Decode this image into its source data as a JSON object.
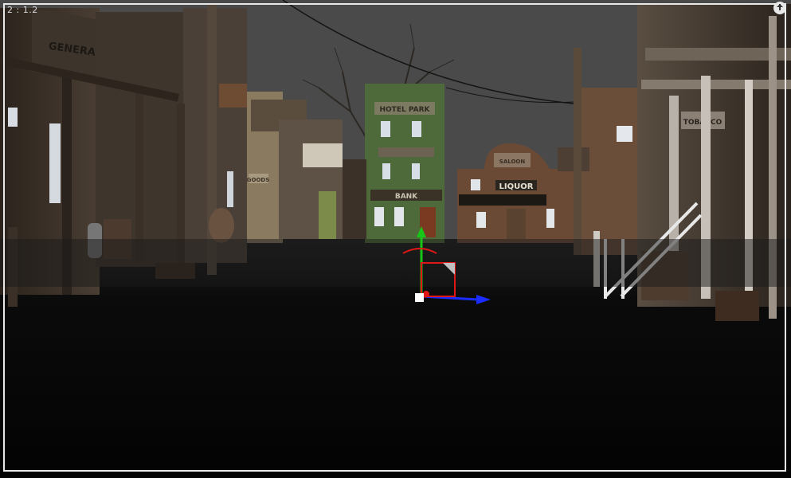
{
  "viewport": {
    "aspect_label": "2 : 1.2",
    "signs": {
      "left_building": "GENERAL STORE",
      "green_building_top": "HOTEL PARK",
      "green_building_mid": "BANK",
      "center_dome": "SALOON",
      "center_liquor": "LIQUOR",
      "left_small": "GOODS",
      "right_building": "TOBACCO"
    }
  },
  "colors": {
    "sky": "#4a4a4a",
    "ground": "#060606",
    "gizmo_x": "#1a2cff",
    "gizmo_y": "#17c617",
    "gizmo_z": "#e01717"
  }
}
